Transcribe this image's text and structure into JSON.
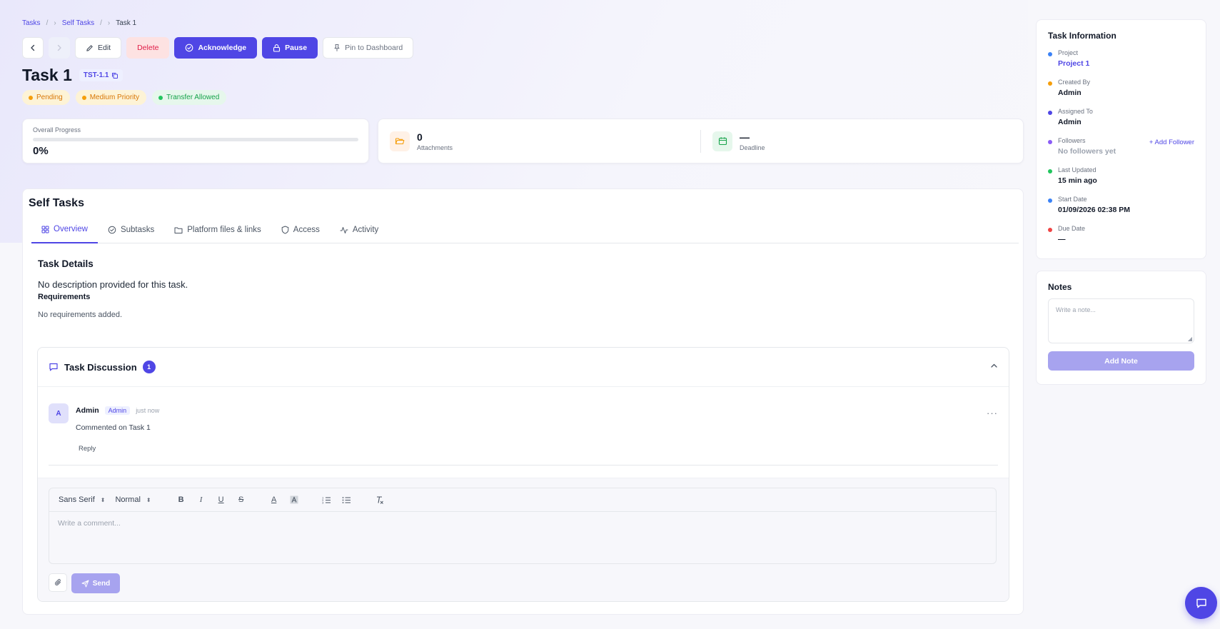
{
  "breadcrumb": {
    "items": [
      "Tasks",
      "Self Tasks"
    ],
    "current": "Task 1",
    "separator": "/"
  },
  "toolbar": {
    "edit_label": "Edit",
    "delete_label": "Delete",
    "acknowledge_label": "Acknowledge",
    "pause_label": "Pause",
    "pin_label": "Pin to Dashboard"
  },
  "task": {
    "title": "Task 1",
    "code": "TST-1.1",
    "status": "Pending",
    "priority": "Medium Priority",
    "transfer": "Transfer Allowed"
  },
  "progress": {
    "label": "Overall Progress",
    "value_text": "0%",
    "fraction": 0
  },
  "stats": {
    "attachments_count": "0",
    "attachments_label": "Attachments",
    "deadline_value": "—",
    "deadline_label": "Deadline"
  },
  "panel": {
    "title": "Self Tasks",
    "tabs": [
      {
        "label": "Overview",
        "icon": "grid-icon"
      },
      {
        "label": "Subtasks",
        "icon": "check-circle-icon"
      },
      {
        "label": "Platform files & links",
        "icon": "folder-icon"
      },
      {
        "label": "Access",
        "icon": "shield-icon"
      },
      {
        "label": "Activity",
        "icon": "activity-icon"
      }
    ]
  },
  "details": {
    "title": "Task Details",
    "description": "No description provided for this task.",
    "requirements_title": "Requirements",
    "requirements_empty": "No requirements added."
  },
  "discussion": {
    "title": "Task Discussion",
    "count": "1",
    "comment": {
      "avatar": "A",
      "author": "Admin",
      "role": "Admin",
      "time": "just now",
      "text": "Commented on Task 1",
      "reply_label": "Reply",
      "more": "···"
    },
    "editor": {
      "font": "Sans Serif",
      "size": "Normal",
      "placeholder": "Write a comment...",
      "send_label": "Send"
    }
  },
  "info": {
    "title": "Task Information",
    "project_label": "Project",
    "project_value": "Project 1",
    "created_label": "Created By",
    "created_value": "Admin",
    "assigned_label": "Assigned To",
    "assigned_value": "Admin",
    "followers_label": "Followers",
    "followers_value": "No followers yet",
    "add_follower_label": "+ Add Follower",
    "updated_label": "Last Updated",
    "updated_value": "15 min ago",
    "start_label": "Start Date",
    "start_value": "01/09/2026 02:38 PM",
    "due_label": "Due Date",
    "due_value": "—"
  },
  "notes": {
    "title": "Notes",
    "placeholder": "Write a note...",
    "add_label": "Add Note"
  },
  "colors": {
    "accent": "#4f46e5",
    "project_dot": "#3b82f6",
    "created_dot": "#f59e0b",
    "assigned_dot": "#4f46e5",
    "followers_dot": "#8b5cf6",
    "updated_dot": "#22c55e",
    "start_dot": "#3b82f6",
    "due_dot": "#ef4444"
  }
}
